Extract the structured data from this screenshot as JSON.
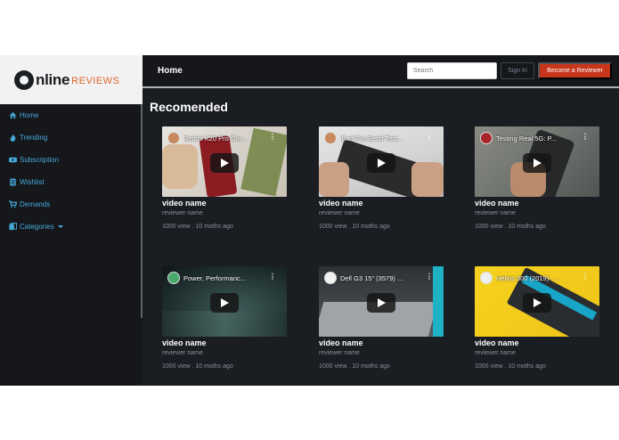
{
  "brand": {
    "logo_main": "nline",
    "logo_accent": "REVIEWS"
  },
  "sidebar": {
    "items": [
      {
        "label": "Home",
        "icon": "home-icon"
      },
      {
        "label": "Trending",
        "icon": "fire-icon"
      },
      {
        "label": "Subscription",
        "icon": "play-icon"
      },
      {
        "label": "Wishlist",
        "icon": "list-icon"
      },
      {
        "label": "Demands",
        "icon": "cart-icon"
      },
      {
        "label": "Categories",
        "icon": "categories-icon"
      }
    ]
  },
  "topbar": {
    "title": "Home",
    "search_placeholder": "Search",
    "signin_label": "Sign In",
    "become_label": "Become a Reviewer"
  },
  "main": {
    "heading": "Recomended",
    "videos": [
      {
        "thumb_title": "Redmi K20 Pro Dur...",
        "name": "video name",
        "reviewer": "reviewer name",
        "views": "1000 view",
        "age": "10 moths ago"
      },
      {
        "thumb_title": "iPad Pro Bend Test...",
        "name": "video name",
        "reviewer": "reviewer name",
        "views": "1000 view",
        "age": "10 moths ago"
      },
      {
        "thumb_title": "Testing Real 5G: P...",
        "name": "video name",
        "reviewer": "reviewer name",
        "views": "1000 view",
        "age": "10 moths ago"
      },
      {
        "thumb_title": "Power, Performanc...",
        "name": "video name",
        "reviewer": "reviewer name",
        "views": "1000 view",
        "age": "10 moths ago"
      },
      {
        "thumb_title": "Dell G3 15\" (3579) ...",
        "name": "video name",
        "reviewer": "reviewer name",
        "views": "1000 view",
        "age": "10 moths ago"
      },
      {
        "thumb_title": "Helios 300 (2019) - ...",
        "name": "video name",
        "reviewer": "reviewer name",
        "views": "1000 view",
        "age": "10 moths ago"
      }
    ]
  },
  "colors": {
    "accent": "#46a8d8",
    "primary_button": "#c7361b",
    "background": "#1a1d22",
    "logo_accent": "#e0662a"
  }
}
